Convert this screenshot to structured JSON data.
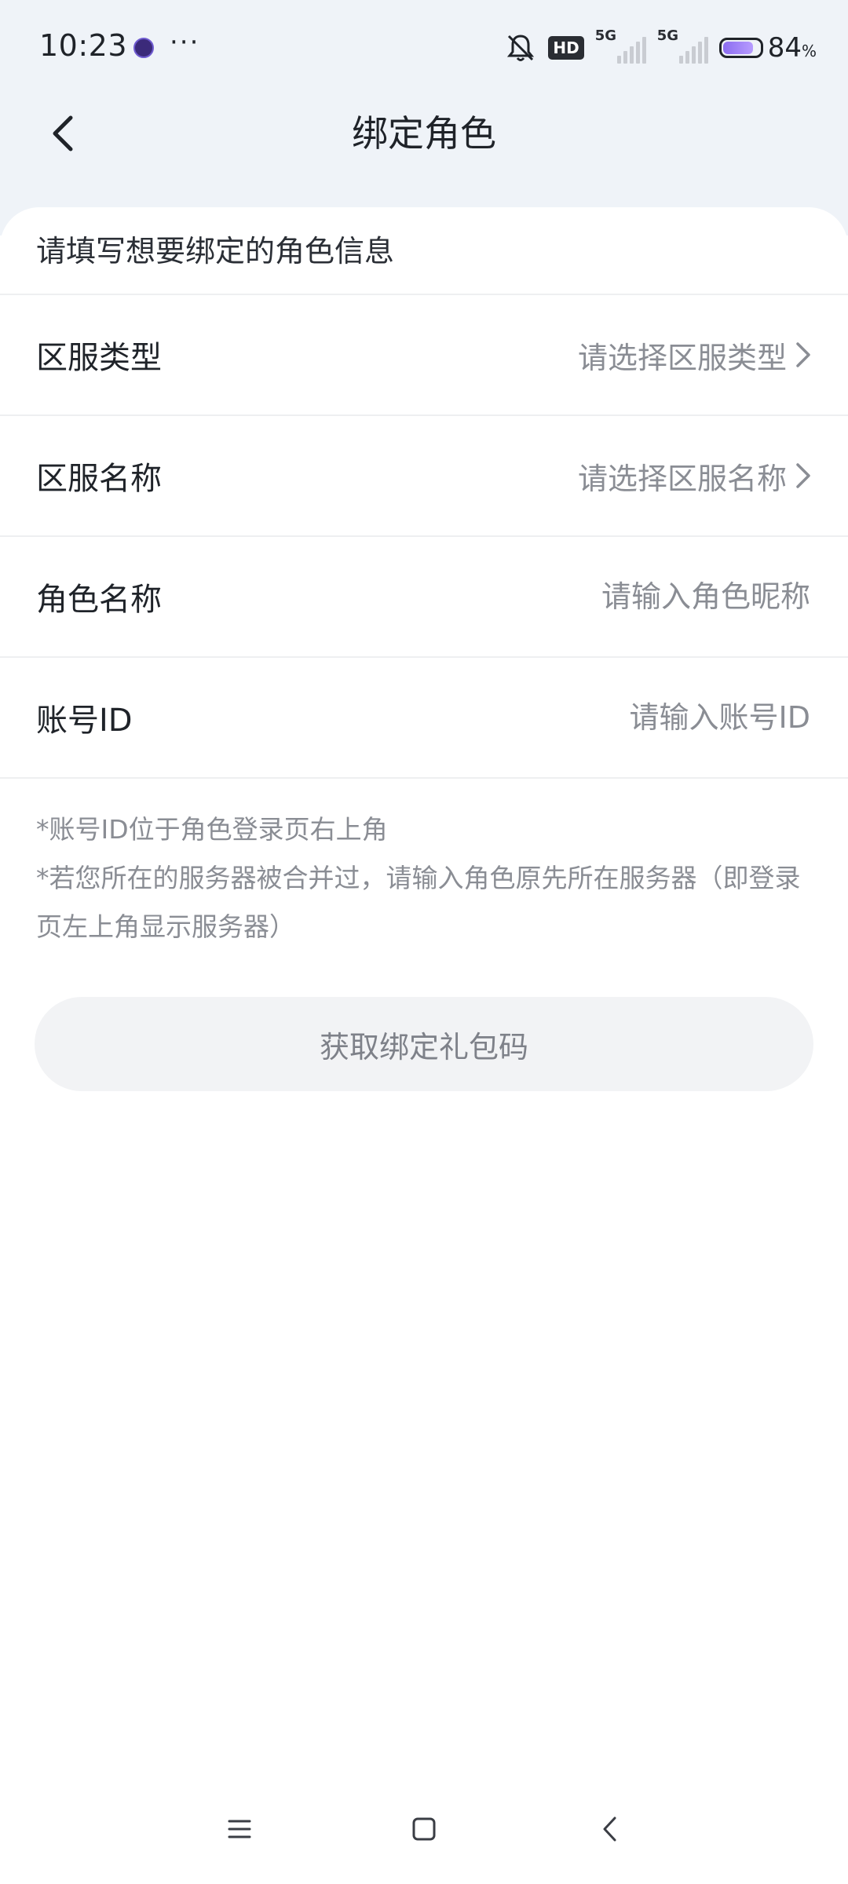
{
  "status_bar": {
    "time": "10:23",
    "more": "···",
    "hd_label": "HD",
    "network_1": "5G",
    "network_2": "5G",
    "battery_percent": "84",
    "battery_unit": "%",
    "battery_level": 0.84
  },
  "header": {
    "title": "绑定角色"
  },
  "form": {
    "intro": "请填写想要绑定的角色信息",
    "rows": [
      {
        "label": "区服类型",
        "value": "请选择区服类型"
      },
      {
        "label": "区服名称",
        "value": "请选择区服名称"
      },
      {
        "label": "角色名称",
        "placeholder": "请输入角色昵称"
      },
      {
        "label": "账号ID",
        "placeholder": "请输入账号ID"
      }
    ]
  },
  "notes": {
    "line1": "*账号ID位于角色登录页右上角",
    "line2": "*若您所在的服务器被合并过，请输入角色原先所在服务器（即登录页左上角显示服务器）"
  },
  "submit": {
    "label": "获取绑定礼包码"
  },
  "colors": {
    "header_bg": "#eff3f8",
    "placeholder": "#8a8d94",
    "button_bg": "#f2f3f5",
    "battery_accent": "#8b6cf0"
  }
}
